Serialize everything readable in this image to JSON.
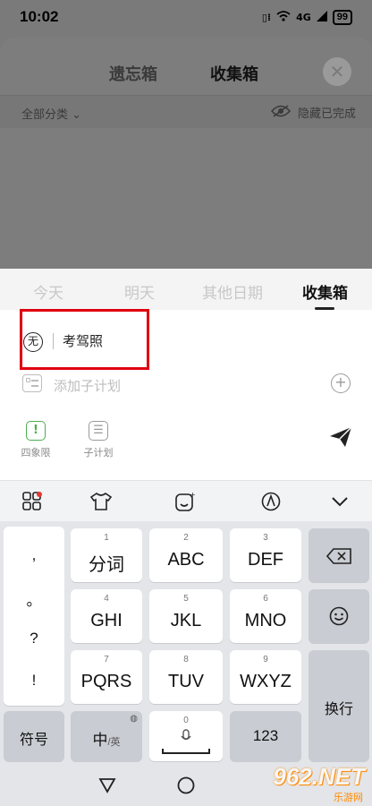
{
  "status_bar": {
    "time": "10:02",
    "network": "4G",
    "battery": "99"
  },
  "top_tabs": [
    {
      "label": "遗忘箱"
    },
    {
      "label": "收集箱"
    }
  ],
  "filter": {
    "label": "全部分类",
    "hide_completed": "隐藏已完成"
  },
  "date_tabs": [
    {
      "label": "今天"
    },
    {
      "label": "明天"
    },
    {
      "label": "其他日期"
    },
    {
      "label": "收集箱"
    }
  ],
  "active_date_tab": "收集箱",
  "task": {
    "priority_badge": "无",
    "text": "考驾照",
    "subplan_placeholder": "添加子计划"
  },
  "tools": [
    {
      "label": "四象限",
      "icon": "quadrant-icon"
    },
    {
      "label": "子计划",
      "icon": "subplan-icon"
    }
  ],
  "keyboard": {
    "keys": [
      {
        "num": "1",
        "label": "分词"
      },
      {
        "num": "2",
        "label": "ABC"
      },
      {
        "num": "3",
        "label": "DEF"
      },
      {
        "num": "4",
        "label": "GHI"
      },
      {
        "num": "5",
        "label": "JKL"
      },
      {
        "num": "6",
        "label": "MNO"
      },
      {
        "num": "7",
        "label": "PQRS"
      },
      {
        "num": "8",
        "label": "TUV"
      },
      {
        "num": "9",
        "label": "WXYZ"
      }
    ],
    "punct": [
      ",",
      "。",
      "?",
      "!"
    ],
    "symbols_label": "符号",
    "lang_main": "中",
    "lang_alt": "/英",
    "space_num": "0",
    "numbers_label": "123",
    "newline_label": "换行"
  },
  "watermark": {
    "brand": "962.NET",
    "sub": "乐游网"
  },
  "colors": {
    "highlight": "#e0000f",
    "dim": "#7a7a7a",
    "keyboard_bg": "#e3e5e9"
  }
}
